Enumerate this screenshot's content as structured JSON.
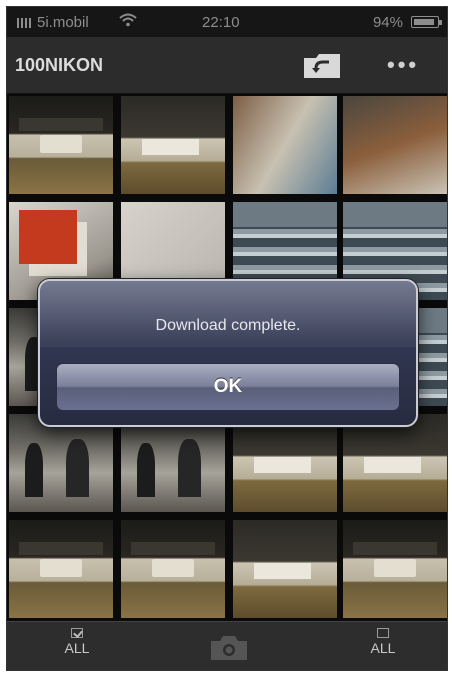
{
  "status_bar": {
    "carrier": "5i.mobil",
    "time": "22:10",
    "battery": "94%"
  },
  "nav": {
    "title": "100NIKON"
  },
  "dialog": {
    "message": "Download complete.",
    "ok_label": "OK"
  },
  "toolbar": {
    "select_all_label": "ALL",
    "deselect_all_label": "ALL"
  },
  "thumbnails": [
    "t-desk",
    "t-desk2",
    "t-frame4",
    "t-frame3",
    "t-frame1",
    "t-blank",
    "t-class",
    "t-class",
    "t-people",
    "t-screen",
    "t-class",
    "t-class",
    "t-people",
    "t-people",
    "t-desk2",
    "t-desk2",
    "t-desk",
    "t-desk",
    "t-desk2",
    "t-desk"
  ],
  "colors": {
    "background": "#0a0a0a",
    "nav_bar": "#2c2c2c",
    "dialog": "#323852",
    "toolbar": "#2d2d2d"
  },
  "icons": [
    "wifi-icon",
    "battery-icon",
    "folder-back-icon",
    "more-icon",
    "checkbox-checked-icon",
    "camera-icon",
    "checkbox-empty-icon"
  ]
}
